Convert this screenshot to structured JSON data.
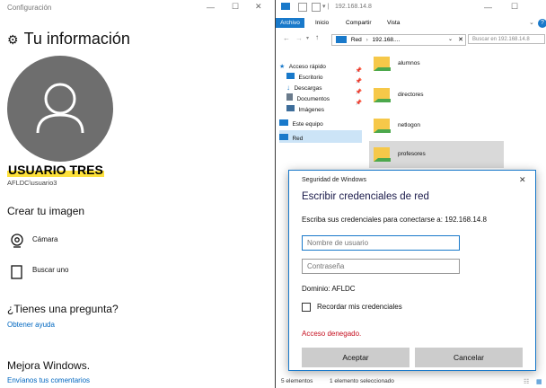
{
  "settings": {
    "window_title": "Configuración",
    "controls": {
      "minimize": "—",
      "maximize": "☐",
      "close": "✕"
    },
    "page_title": "Tu información",
    "username": "USUARIO TRES",
    "account": "AFLDC\\usuario3",
    "create_image_heading": "Crear tu imagen",
    "camera_label": "Cámara",
    "browse_label": "Buscar uno",
    "question_heading": "¿Tienes una pregunta?",
    "help_link": "Obtener ayuda",
    "improve_heading": "Mejora Windows.",
    "feedback_link": "Envíanos tus comentarios"
  },
  "explorer": {
    "title_path": "192.168.14.8",
    "controls": {
      "minimize": "—",
      "maximize": "☐"
    },
    "ribbon_tabs": [
      "Archivo",
      "Inicio",
      "Compartir",
      "Vista"
    ],
    "address": {
      "root": "Red",
      "separator": "›",
      "host": "192.168...."
    },
    "search_placeholder": "Buscar en 192.168.14.8",
    "nav": {
      "quick_access": "Acceso rápido",
      "desktop": "Escritorio",
      "downloads": "Descargas",
      "documents": "Documentos",
      "pictures": "Imágenes",
      "this_pc": "Este equipo",
      "network": "Red"
    },
    "folders": [
      "alumnos",
      "directores",
      "netlogon",
      "profesores"
    ],
    "status": {
      "count": "5 elementos",
      "selected": "1 elemento seleccionado"
    }
  },
  "dialog": {
    "window_title": "Seguridad de Windows",
    "close": "✕",
    "heading": "Escribir credenciales de red",
    "prompt": "Escriba sus credenciales para conectarse a: 192.168.14.8",
    "username_placeholder": "Nombre de usuario",
    "password_placeholder": "Contraseña",
    "domain": "Dominio: AFLDC",
    "remember_label": "Recordar mis credenciales",
    "error": "Acceso denegado.",
    "accept": "Aceptar",
    "cancel": "Cancelar"
  },
  "colors": {
    "accent": "#1979ca",
    "highlight": "#fde03a",
    "error": "#c50f1f",
    "folder": "#f6c849"
  }
}
